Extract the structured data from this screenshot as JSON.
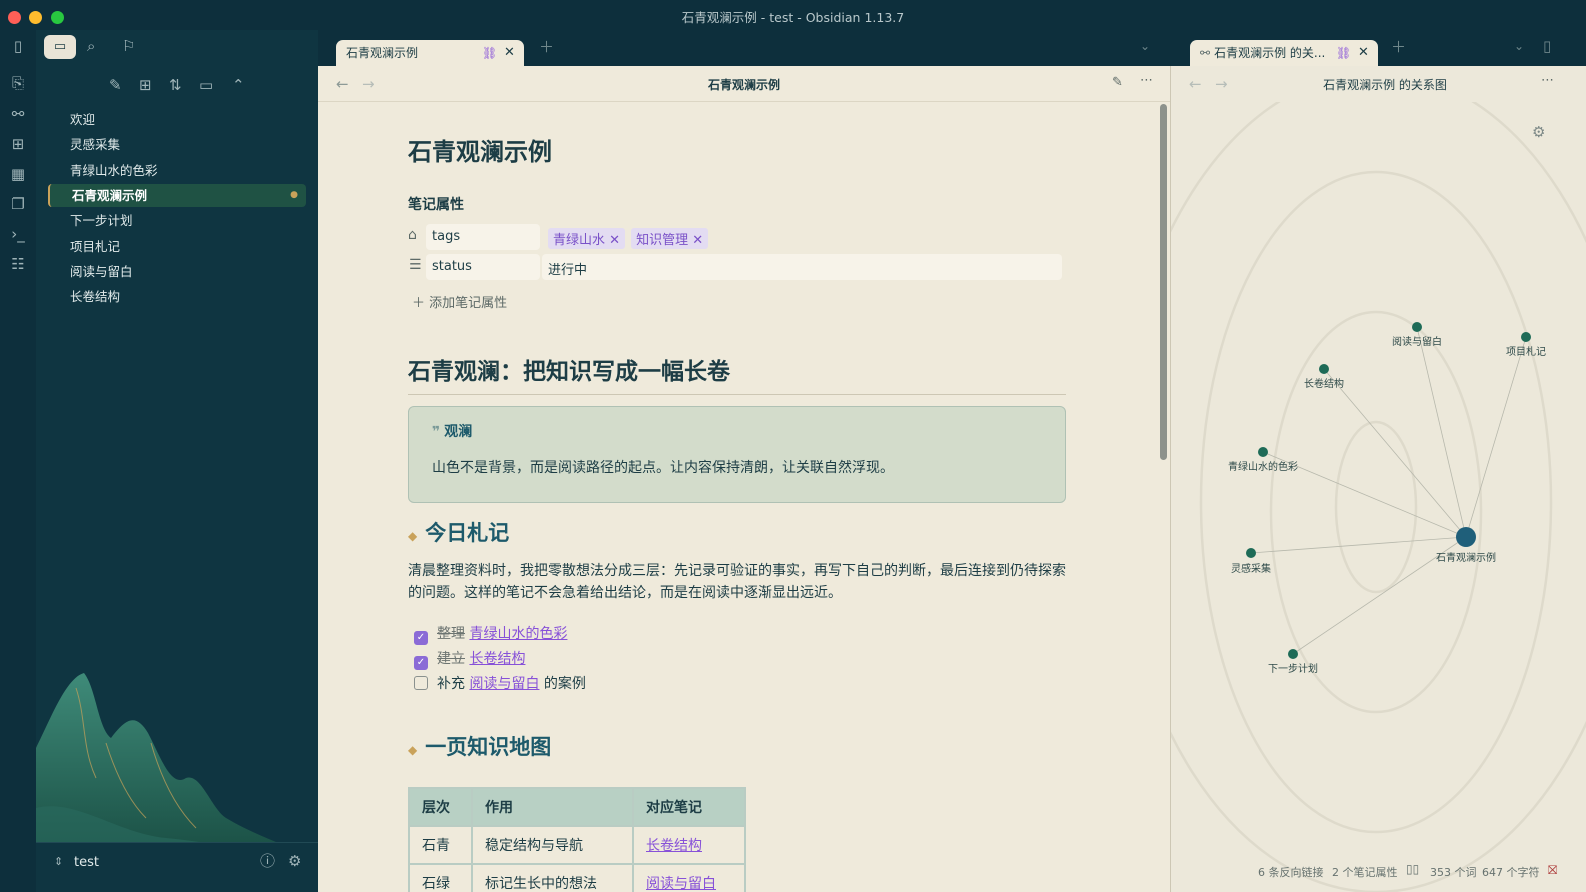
{
  "window": {
    "title": "石青观澜示例 - test - Obsidian 1.13.7"
  },
  "tabs": {
    "left": {
      "label": "石青观澜示例"
    },
    "right": {
      "label": "石青观澜示例 的关..."
    }
  },
  "sidebar": {
    "files": [
      "欢迎",
      "灵感采集",
      "青绿山水的色彩",
      "石青观澜示例",
      "下一步计划",
      "项目札记",
      "阅读与留白",
      "长卷结构"
    ],
    "active_index": 3,
    "vault": "test"
  },
  "main": {
    "view_title": "石青观澜示例",
    "doc_title": "石青观澜示例",
    "properties": {
      "heading": "笔记属性",
      "tags_label": "tags",
      "tags": [
        "青绿山水",
        "知识管理"
      ],
      "status_label": "status",
      "status_value": "进行中",
      "add_label": "添加笔记属性"
    },
    "h1": "石青观澜：把知识写成一幅长卷",
    "callout": {
      "title": "观澜",
      "body": "山色不是背景，而是阅读路径的起点。让内容保持清朗，让关联自然浮现。"
    },
    "h2_today": "今日札记",
    "paragraph": "清晨整理资料时，我把零散想法分成三层：先记录可验证的事实，再写下自己的判断，最后连接到仍待探索的问题。这样的笔记不会急着给出结论，而是在阅读中逐渐显出远近。",
    "tasks": [
      {
        "prefix": "整理",
        "link": "青绿山水的色彩",
        "suffix": "",
        "done": true
      },
      {
        "prefix": "建立",
        "link": "长卷结构",
        "suffix": "",
        "done": true
      },
      {
        "prefix": "补充",
        "link": "阅读与留白",
        "suffix": "的案例",
        "done": false
      }
    ],
    "h2_map": "一页知识地图",
    "table": {
      "headers": [
        "层次",
        "作用",
        "对应笔记"
      ],
      "rows": [
        [
          "石青",
          "稳定结构与导航",
          "长卷结构"
        ],
        [
          "石绿",
          "标记生长中的想法",
          "阅读与留白"
        ]
      ]
    }
  },
  "graph": {
    "title": "石青观澜示例 的关系图",
    "nodes": [
      "阅读与留白",
      "项目札记",
      "长卷结构",
      "青绿山水的色彩",
      "石青观澜示例",
      "灵感采集",
      "下一步计划"
    ]
  },
  "status": {
    "backlinks": "6 条反向链接",
    "props": "2 个笔记属性",
    "words": "353 个词",
    "chars": "647 个字符"
  }
}
